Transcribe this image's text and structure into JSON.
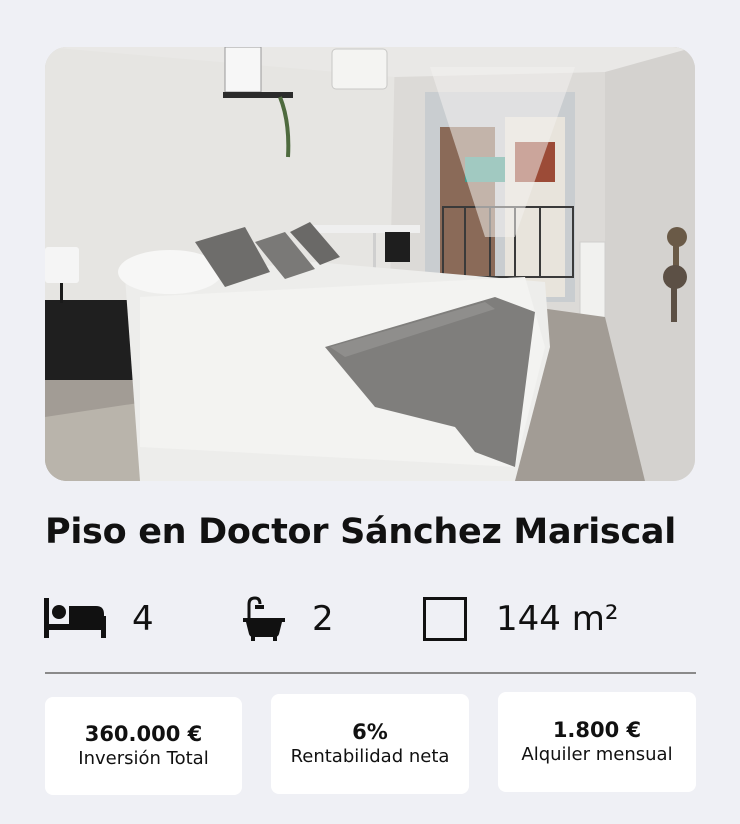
{
  "listing": {
    "title": "Piso en Doctor Sánchez Mariscal",
    "photo_alt": "Bedroom"
  },
  "features": {
    "bedrooms": {
      "icon": "bed-icon",
      "value": "4"
    },
    "bathrooms": {
      "icon": "bathtub-icon",
      "value": "2"
    },
    "area": {
      "icon": "area-square-icon",
      "value": "144 m²"
    }
  },
  "stats": [
    {
      "value": "360.000 €",
      "label": "Inversión Total"
    },
    {
      "value": "6%",
      "label": "Rentabilidad neta"
    },
    {
      "value": "1.800 €",
      "label": "Alquiler mensual"
    }
  ],
  "colors": {
    "background": "#eff0f5",
    "card": "#ffffff",
    "text": "#111111",
    "divider": "#8a8a8a"
  }
}
